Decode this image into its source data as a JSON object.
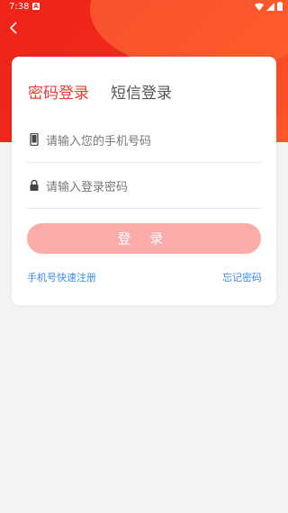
{
  "status_bar": {
    "time": "7:38",
    "notif_letter": "A",
    "wifi": "wifi-icon",
    "signal": "signal-icon",
    "battery": "battery-icon"
  },
  "tabs": [
    {
      "label": "密码登录",
      "active": true
    },
    {
      "label": "短信登录",
      "active": false
    }
  ],
  "fields": {
    "phone_placeholder": "请输入您的手机号码",
    "password_placeholder": "请输入登录密码"
  },
  "login_button": "登 录",
  "links": {
    "register": "手机号快速注册",
    "forgot": "忘记密码"
  },
  "colors": {
    "brand": "#f02318",
    "active_tab": "#f03a2e",
    "button": "#fdaaaa",
    "link": "#3a8be8"
  }
}
